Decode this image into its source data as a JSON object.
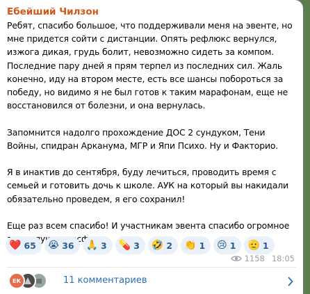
{
  "message": {
    "author": "Ебейший Чилзон",
    "paragraphs": [
      "Ребят, спасибо большое, что поддерживали меня на эвенте, но мне придется сойти с дистанции. Опять рефлюкс вернулся, изжога дикая, грудь болит, невозможно сидеть за компом. Последние пару дней я прям терпел из последних сил. Жаль конечно, иду на втором месте, есть все шансы побороться за победу, но видимо я не был готов к таким марафонам, еще не восстановился от болезни, и она вернулась.",
      "Запомнится надолго прохождение ДОС 2 сундуком, Тени Войны, спидран Арканума, МГР и Япи Психо. Ну и Факторио.",
      "Я в инактив до сентября, буду лечиться, проводить время с семьей и готовить дочь к школе. АУК на который вы накидали обязательно проведем, я его сохранил!",
      "Еще раз всем спасибо! И участникам эвента спасибо огромное за теплую атмосферу."
    ],
    "reactions": [
      {
        "emoji": "❤️",
        "count": "65"
      },
      {
        "emoji": "😭",
        "count": "36"
      },
      {
        "emoji": "🙏",
        "count": "3"
      },
      {
        "emoji": "💊",
        "count": "3"
      },
      {
        "emoji": "🤣",
        "count": "2"
      },
      {
        "emoji": "👏",
        "count": "1"
      },
      {
        "emoji": "😢",
        "count": "1"
      },
      {
        "emoji": "🫡",
        "count": "1"
      }
    ],
    "views": "1158",
    "time": "18:05"
  },
  "comments": {
    "label": "11 комментариев",
    "avatars": [
      {
        "initials": "ЕК",
        "color": "#e76b4a"
      },
      {
        "initials": "",
        "color": "#4a4a4a"
      },
      {
        "initials": "",
        "color": "#9aa7a0"
      }
    ]
  }
}
